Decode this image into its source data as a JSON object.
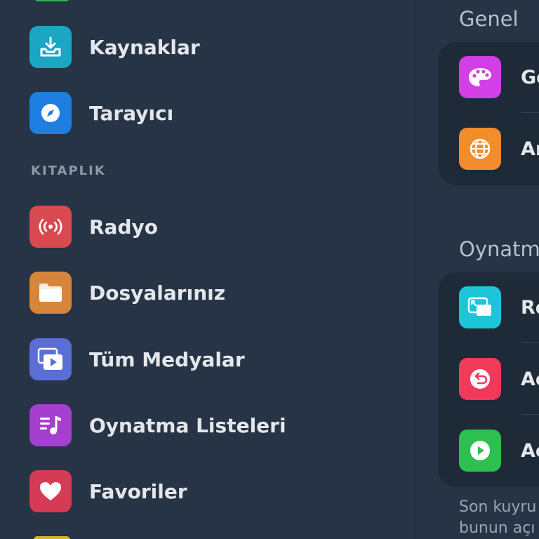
{
  "sidebar": {
    "items_top": [
      {
        "label": "Kaynaklar",
        "icon": "inbox-download-icon",
        "color": "#1ba6c4"
      },
      {
        "label": "Tarayıcı",
        "icon": "compass-icon",
        "color": "#1f7fe0"
      }
    ],
    "section_label": "KITAPLIK",
    "library": [
      {
        "label": "Radyo",
        "icon": "broadcast-icon",
        "color": "#d84a4f"
      },
      {
        "label": "Dosyalarınız",
        "icon": "folder-icon",
        "color": "#d8853c"
      },
      {
        "label": "Tüm Medyalar",
        "icon": "media-stack-icon",
        "color": "#5b6ed6"
      },
      {
        "label": "Oynatma Listeleri",
        "icon": "playlist-icon",
        "color": "#a43fd0"
      },
      {
        "label": "Favoriler",
        "icon": "heart-icon",
        "color": "#d63b55"
      }
    ]
  },
  "settings": {
    "general_header": "Genel",
    "general_items": [
      {
        "label": "Gö",
        "icon": "palette-icon",
        "color": "#d33fe6"
      },
      {
        "label": "Ar",
        "icon": "globe-icon",
        "color": "#f38c2a"
      }
    ],
    "playback_header": "Oynatm",
    "playback_items": [
      {
        "label": "Re",
        "icon": "picture-in-picture-icon",
        "color": "#1cc6d8"
      },
      {
        "label": "Aç",
        "icon": "undo-circle-icon",
        "color": "#f1395a"
      },
      {
        "label": "Aç",
        "icon": "play-circle-icon",
        "color": "#2dbf4f"
      }
    ],
    "footer_line1": "Son kuyru",
    "footer_line2": "bunun açı"
  }
}
